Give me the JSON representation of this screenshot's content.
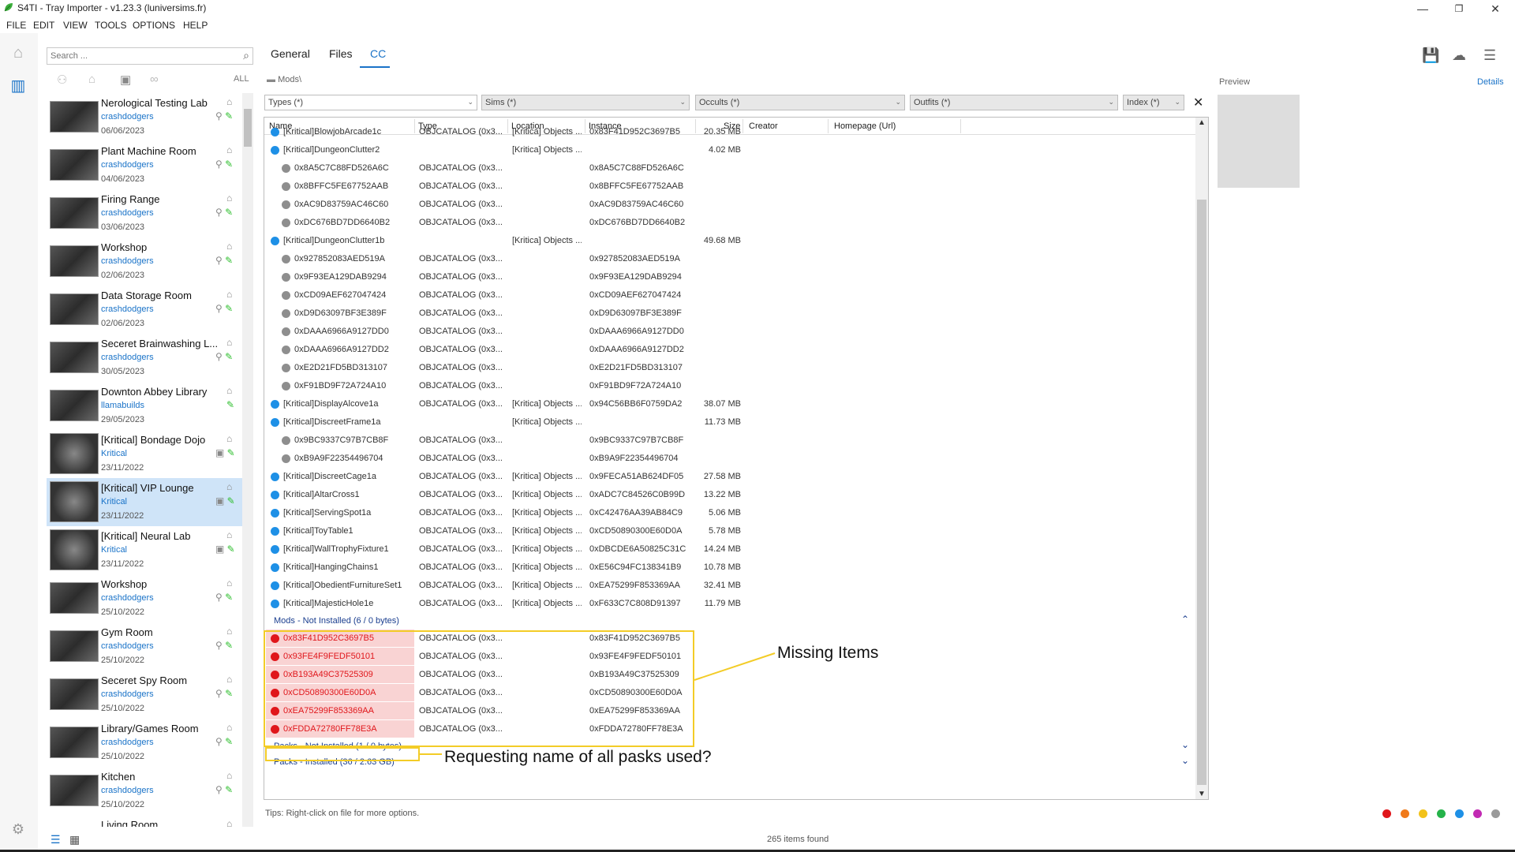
{
  "window": {
    "title": "S4TI - Tray Importer - v1.23.3  (luniversims.fr)",
    "minimize": "—",
    "restore": "❐",
    "close": "✕"
  },
  "menu": [
    "FILE",
    "EDIT",
    "VIEW",
    "TOOLS",
    "OPTIONS",
    "HELP"
  ],
  "search": {
    "placeholder": "Search ..."
  },
  "filter_all": "ALL",
  "tray_items": [
    {
      "name": "Nerological Testing Lab",
      "author": "crashdodgers",
      "date": "06/06/2023"
    },
    {
      "name": "Plant Machine Room",
      "author": "crashdodgers",
      "date": "04/06/2023"
    },
    {
      "name": "Firing Range",
      "author": "crashdodgers",
      "date": "03/06/2023"
    },
    {
      "name": "Workshop",
      "author": "crashdodgers",
      "date": "02/06/2023"
    },
    {
      "name": "Data Storage Room",
      "author": "crashdodgers",
      "date": "02/06/2023"
    },
    {
      "name": "Seceret  Brainwashing L...",
      "author": "crashdodgers",
      "date": "30/05/2023"
    },
    {
      "name": "Downton Abbey Library",
      "author": "llamabuilds",
      "date": "29/05/2023"
    },
    {
      "name": "[Kritical] Bondage Dojo",
      "author": "Kritical",
      "date": "23/11/2022"
    },
    {
      "name": "[Kritical] VIP Lounge",
      "author": "Kritical",
      "date": "23/11/2022"
    },
    {
      "name": "[Kritical] Neural Lab",
      "author": "Kritical",
      "date": "23/11/2022"
    },
    {
      "name": "Workshop",
      "author": "crashdodgers",
      "date": "25/10/2022"
    },
    {
      "name": "Gym Room",
      "author": "crashdodgers",
      "date": "25/10/2022"
    },
    {
      "name": "Seceret Spy Room",
      "author": "crashdodgers",
      "date": "25/10/2022"
    },
    {
      "name": "Library/Games Room",
      "author": "crashdodgers",
      "date": "25/10/2022"
    },
    {
      "name": "Kitchen",
      "author": "crashdodgers",
      "date": "25/10/2022"
    },
    {
      "name": "Living Room",
      "author": "",
      "date": ""
    }
  ],
  "tabs": [
    "General",
    "Files",
    "CC"
  ],
  "breadcrumb": "Mods\\",
  "filters": {
    "types": "Types (*)",
    "sims": "Sims (*)",
    "occults": "Occults (*)",
    "outfits": "Outfits (*)",
    "index": "Index (*)"
  },
  "columns": [
    "Name",
    "Type",
    "Location",
    "Instance",
    "Size",
    "Creator",
    "Homepage (Url)"
  ],
  "rows": [
    {
      "dot": "blue",
      "indent": 0,
      "name": "[Kritical]BlowjobArcade1c",
      "type": "OBJCATALOG (0x3...",
      "location": "[Kritica] Objects ...",
      "instance": "0x83F41D952C3697B5",
      "size": "20.35 MB"
    },
    {
      "dot": "blue",
      "indent": 0,
      "name": "[Kritical]DungeonClutter2",
      "type": "",
      "location": "[Kritica] Objects ...",
      "instance": "",
      "size": "4.02 MB"
    },
    {
      "dot": "gray",
      "indent": 1,
      "name": "0x8A5C7C88FD526A6C",
      "type": "OBJCATALOG (0x3...",
      "location": "",
      "instance": "0x8A5C7C88FD526A6C",
      "size": ""
    },
    {
      "dot": "gray",
      "indent": 1,
      "name": "0x8BFFC5FE67752AAB",
      "type": "OBJCATALOG (0x3...",
      "location": "",
      "instance": "0x8BFFC5FE67752AAB",
      "size": ""
    },
    {
      "dot": "gray",
      "indent": 1,
      "name": "0xAC9D83759AC46C60",
      "type": "OBJCATALOG (0x3...",
      "location": "",
      "instance": "0xAC9D83759AC46C60",
      "size": ""
    },
    {
      "dot": "gray",
      "indent": 1,
      "name": "0xDC676BD7DD6640B2",
      "type": "OBJCATALOG (0x3...",
      "location": "",
      "instance": "0xDC676BD7DD6640B2",
      "size": ""
    },
    {
      "dot": "blue",
      "indent": 0,
      "name": "[Kritical]DungeonClutter1b",
      "type": "",
      "location": "[Kritica] Objects ...",
      "instance": "",
      "size": "49.68 MB"
    },
    {
      "dot": "gray",
      "indent": 1,
      "name": "0x927852083AED519A",
      "type": "OBJCATALOG (0x3...",
      "location": "",
      "instance": "0x927852083AED519A",
      "size": ""
    },
    {
      "dot": "gray",
      "indent": 1,
      "name": "0x9F93EA129DAB9294",
      "type": "OBJCATALOG (0x3...",
      "location": "",
      "instance": "0x9F93EA129DAB9294",
      "size": ""
    },
    {
      "dot": "gray",
      "indent": 1,
      "name": "0xCD09AEF627047424",
      "type": "OBJCATALOG (0x3...",
      "location": "",
      "instance": "0xCD09AEF627047424",
      "size": ""
    },
    {
      "dot": "gray",
      "indent": 1,
      "name": "0xD9D63097BF3E389F",
      "type": "OBJCATALOG (0x3...",
      "location": "",
      "instance": "0xD9D63097BF3E389F",
      "size": ""
    },
    {
      "dot": "gray",
      "indent": 1,
      "name": "0xDAAA6966A9127DD0",
      "type": "OBJCATALOG (0x3...",
      "location": "",
      "instance": "0xDAAA6966A9127DD0",
      "size": ""
    },
    {
      "dot": "gray",
      "indent": 1,
      "name": "0xDAAA6966A9127DD2",
      "type": "OBJCATALOG (0x3...",
      "location": "",
      "instance": "0xDAAA6966A9127DD2",
      "size": ""
    },
    {
      "dot": "gray",
      "indent": 1,
      "name": "0xE2D21FD5BD313107",
      "type": "OBJCATALOG (0x3...",
      "location": "",
      "instance": "0xE2D21FD5BD313107",
      "size": ""
    },
    {
      "dot": "gray",
      "indent": 1,
      "name": "0xF91BD9F72A724A10",
      "type": "OBJCATALOG (0x3...",
      "location": "",
      "instance": "0xF91BD9F72A724A10",
      "size": ""
    },
    {
      "dot": "blue",
      "indent": 0,
      "name": "[Kritical]DisplayAlcove1a",
      "type": "OBJCATALOG (0x3...",
      "location": "[Kritica] Objects ...",
      "instance": "0x94C56BB6F0759DA2",
      "size": "38.07 MB"
    },
    {
      "dot": "blue",
      "indent": 0,
      "name": "[Kritical]DiscreetFrame1a",
      "type": "",
      "location": "[Kritica] Objects ...",
      "instance": "",
      "size": "11.73 MB"
    },
    {
      "dot": "gray",
      "indent": 1,
      "name": "0x9BC9337C97B7CB8F",
      "type": "OBJCATALOG (0x3...",
      "location": "",
      "instance": "0x9BC9337C97B7CB8F",
      "size": ""
    },
    {
      "dot": "gray",
      "indent": 1,
      "name": "0xB9A9F22354496704",
      "type": "OBJCATALOG (0x3...",
      "location": "",
      "instance": "0xB9A9F22354496704",
      "size": ""
    },
    {
      "dot": "blue",
      "indent": 0,
      "name": "[Kritical]DiscreetCage1a",
      "type": "OBJCATALOG (0x3...",
      "location": "[Kritica] Objects ...",
      "instance": "0x9FECA51AB624DF05",
      "size": "27.58 MB"
    },
    {
      "dot": "blue",
      "indent": 0,
      "name": "[Kritical]AltarCross1",
      "type": "OBJCATALOG (0x3...",
      "location": "[Kritica] Objects ...",
      "instance": "0xADC7C84526C0B99D",
      "size": "13.22 MB"
    },
    {
      "dot": "blue",
      "indent": 0,
      "name": "[Kritical]ServingSpot1a",
      "type": "OBJCATALOG (0x3...",
      "location": "[Kritica] Objects ...",
      "instance": "0xC42476AA39AB84C9",
      "size": "5.06 MB"
    },
    {
      "dot": "blue",
      "indent": 0,
      "name": "[Kritical]ToyTable1",
      "type": "OBJCATALOG (0x3...",
      "location": "[Kritica] Objects ...",
      "instance": "0xCD50890300E60D0A",
      "size": "5.78 MB"
    },
    {
      "dot": "blue",
      "indent": 0,
      "name": "[Kritical]WallTrophyFixture1",
      "type": "OBJCATALOG (0x3...",
      "location": "[Kritica] Objects ...",
      "instance": "0xDBCDE6A50825C31C",
      "size": "14.24 MB"
    },
    {
      "dot": "blue",
      "indent": 0,
      "name": "[Kritical]HangingChains1",
      "type": "OBJCATALOG (0x3...",
      "location": "[Kritica] Objects ...",
      "instance": "0xE56C94FC138341B9",
      "size": "10.78 MB"
    },
    {
      "dot": "blue",
      "indent": 0,
      "name": "[Kritical]ObedientFurnitureSet1",
      "type": "OBJCATALOG (0x3...",
      "location": "[Kritica] Objects ...",
      "instance": "0xEA75299F853369AA",
      "size": "32.41 MB"
    },
    {
      "dot": "blue",
      "indent": 0,
      "name": "[Kritical]MajesticHole1e",
      "type": "OBJCATALOG (0x3...",
      "location": "[Kritica] Objects ...",
      "instance": "0xF633C7C808D91397",
      "size": "11.79 MB"
    }
  ],
  "groups": {
    "mods_not_installed": "Mods - Not Installed  (6 / 0 bytes)",
    "packs_not_installed": "Packs - Not Installed  (1 / 0 bytes)",
    "packs_installed": "Packs - Installed  (36 / 2.63 GB)"
  },
  "missing_rows": [
    {
      "name": "0x83F41D952C3697B5",
      "type": "OBJCATALOG (0x3...",
      "instance": "0x83F41D952C3697B5"
    },
    {
      "name": "0x93FE4F9FEDF50101",
      "type": "OBJCATALOG (0x3...",
      "instance": "0x93FE4F9FEDF50101"
    },
    {
      "name": "0xB193A49C37525309",
      "type": "OBJCATALOG (0x3...",
      "instance": "0xB193A49C37525309"
    },
    {
      "name": "0xCD50890300E60D0A",
      "type": "OBJCATALOG (0x3...",
      "instance": "0xCD50890300E60D0A"
    },
    {
      "name": "0xEA75299F853369AA",
      "type": "OBJCATALOG (0x3...",
      "instance": "0xEA75299F853369AA"
    },
    {
      "name": "0xFDDA72780FF78E3A",
      "type": "OBJCATALOG (0x3...",
      "instance": "0xFDDA72780FF78E3A"
    }
  ],
  "annotations": {
    "missing_items": "Missing Items",
    "packs_question": "Requesting name of all pasks used?"
  },
  "tips": "Tips:  Right-click on file for more options.",
  "status": "265 items found",
  "preview_label": "Preview",
  "details_link": "Details",
  "color_filters": [
    "#e0161b",
    "#f07a1a",
    "#f2c21a",
    "#25b34a",
    "#1e90e6",
    "#c22ab3",
    "#9a9a9a"
  ],
  "colors": {
    "accent": "#1a73c8",
    "missing": "#e0161b",
    "highlight": "#f3cc27"
  }
}
